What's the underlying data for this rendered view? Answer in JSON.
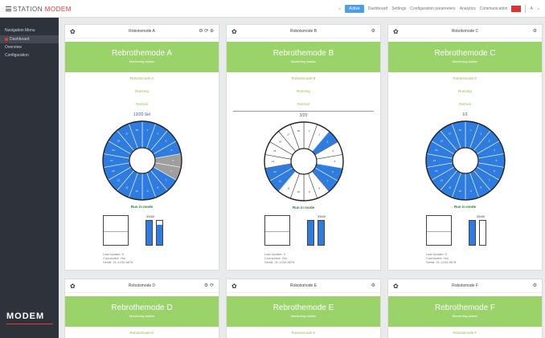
{
  "topbar": {
    "logo_main": "STATION",
    "logo_accent": "MODEM",
    "items": [
      "Dashboard",
      "Settings",
      "Configuration parameters",
      "Analytics",
      "Communication"
    ],
    "active_button": "Active",
    "user": "A"
  },
  "sidebar": {
    "header": "Navigation Menu",
    "items": [
      "Dashboard",
      "Overview",
      "Configuration"
    ],
    "logo": "MODEM"
  },
  "cards": [
    {
      "title": "Robotsmode A",
      "green_title": "Rebrothemode A",
      "green_sub": "Monitoring station",
      "rows": [
        "Robotsmode A",
        "Running",
        "Normal"
      ],
      "cap_label": "13/20 Sel",
      "ok": "Run in mode",
      "bar_label": "33/40",
      "meta": [
        "Last Update: 0",
        "Connected: Yes",
        "Serial: 21-1234-5678"
      ],
      "filled": [
        0,
        1,
        2,
        3,
        6,
        7,
        8,
        9,
        10,
        11,
        12,
        13,
        14,
        15,
        16,
        17
      ],
      "grey": [
        4,
        5
      ]
    },
    {
      "title": "Robotsmode B",
      "green_title": "Rebrothemode B",
      "green_sub": "Monitoring station",
      "rows": [
        "Robotsmode B",
        "Running",
        "Normal"
      ],
      "cap_label": "3/20",
      "ok": "Run in mode",
      "bar_label": "33/40",
      "meta": [
        "Last Update: 0",
        "Connected: Yes",
        "Serial: 21-1234-5678"
      ],
      "filled": [
        2,
        5,
        6,
        11,
        12
      ],
      "grey": []
    },
    {
      "title": "Robotsmode C",
      "green_title": "Rebrothemode C",
      "green_sub": "Monitoring station",
      "rows": [
        "Robotsmode C",
        "Running",
        "Normal"
      ],
      "cap_label": "1/1",
      "ok": "Run in mode",
      "bar_label": "25/40",
      "meta": [
        "Last Update: 0",
        "Connected: Yes",
        "Serial: 21-1234-5678"
      ],
      "filled": "all",
      "grey": []
    },
    {
      "title": "Robotsmode D",
      "green_title": "Rebrothemode D",
      "green_sub": "Monitoring station",
      "rows": [
        "Robotsmode D"
      ]
    },
    {
      "title": "Robotsmode E",
      "green_title": "Rebrothemode E",
      "green_sub": "Monitoring station",
      "rows": [
        "Robotsmode E"
      ]
    },
    {
      "title": "Robotsmode F",
      "green_title": "Rebrothemode F",
      "green_sub": "Monitoring station",
      "rows": [
        "Robotsmode F"
      ]
    }
  ],
  "colors": {
    "green": "#9ad36a",
    "blue": "#2e7ce0",
    "grey_segment": "#9e9e9e",
    "sidebar": "#2e333b"
  }
}
